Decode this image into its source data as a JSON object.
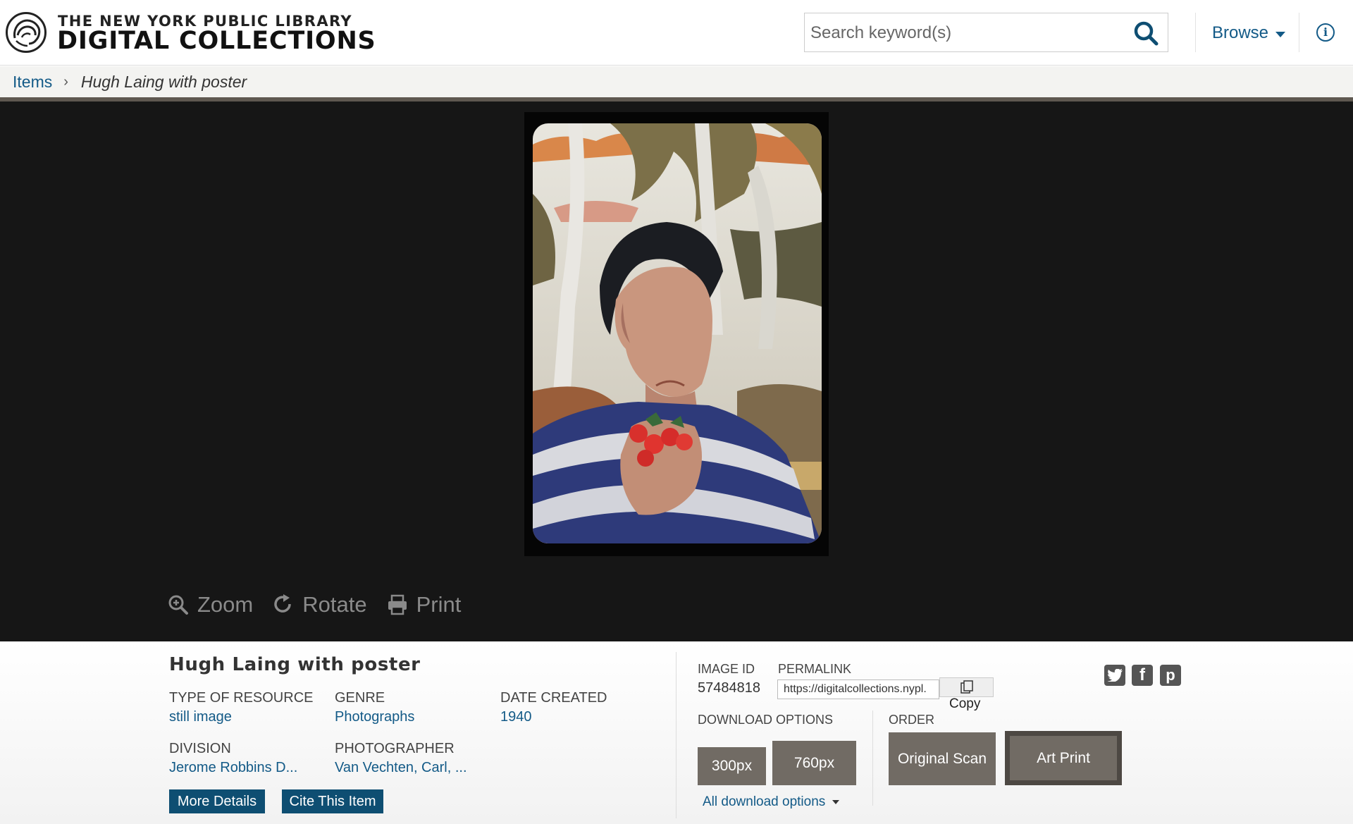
{
  "header": {
    "org_name": "THE NEW YORK PUBLIC LIBRARY",
    "site_name": "DIGITAL COLLECTIONS",
    "search_placeholder": "Search keyword(s)",
    "browse_label": "Browse"
  },
  "breadcrumb": {
    "items_label": "Items",
    "current": "Hugh Laing with poster"
  },
  "viewer": {
    "tools": {
      "zoom": "Zoom",
      "rotate": "Rotate",
      "print": "Print"
    }
  },
  "item": {
    "title": "Hugh Laing with poster",
    "fields": {
      "type_label": "TYPE OF RESOURCE",
      "type_value": "still image",
      "genre_label": "GENRE",
      "genre_value": "Photographs",
      "date_label": "DATE CREATED",
      "date_value": "1940",
      "division_label": "DIVISION",
      "division_value": "Jerome Robbins D...",
      "photographer_label": "PHOTOGRAPHER",
      "photographer_value": "Van Vechten, Carl, ..."
    },
    "more_details": "More Details",
    "cite": "Cite This Item",
    "image_id_label": "IMAGE ID",
    "image_id": "57484818",
    "permalink_label": "PERMALINK",
    "permalink": "https://digitalcollections.nypl.",
    "copy_label": "Copy",
    "download_label": "DOWNLOAD OPTIONS",
    "dl_300": "300px",
    "dl_760": "760px",
    "all_downloads": "All download options",
    "order_label": "ORDER",
    "original_scan": "Original Scan",
    "art_print": "Art Print"
  },
  "colors": {
    "link": "#135a87",
    "button_blue": "#0e4e72",
    "button_grey": "#716b64",
    "viewer_bg": "#161616"
  }
}
